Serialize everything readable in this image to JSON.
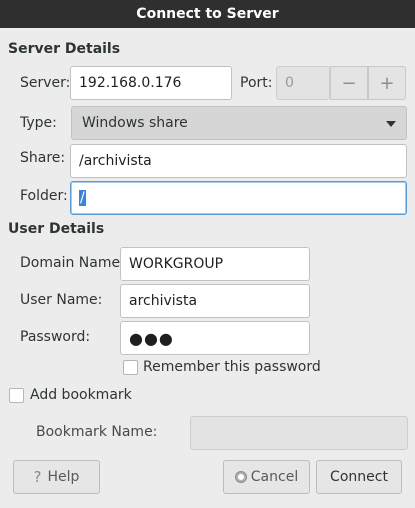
{
  "window": {
    "title": "Connect to Server"
  },
  "server_details": {
    "heading": "Server Details",
    "server_label": "Server:",
    "server_value": "192.168.0.176",
    "port_label": "Port:",
    "port_value": "0",
    "port_minus": "−",
    "port_plus": "+",
    "type_label": "Type:",
    "type_value": "Windows share",
    "share_label": "Share:",
    "share_value": "/archivista",
    "folder_label": "Folder:",
    "folder_value": "/"
  },
  "user_details": {
    "heading": "User Details",
    "domain_label": "Domain Name:",
    "domain_value": "WORKGROUP",
    "user_label": "User Name:",
    "user_value": "archivista",
    "password_label": "Password:",
    "password_value": "●●●",
    "remember_label": "Remember this password"
  },
  "bookmark": {
    "add_label": "Add bookmark",
    "name_label": "Bookmark Name:",
    "name_value": ""
  },
  "buttons": {
    "help": "Help",
    "help_icon": "?",
    "cancel": "Cancel",
    "connect": "Connect"
  },
  "colors": {
    "titlebar": "#2f2f2f",
    "background": "#ececec",
    "selection": "#3b84d6"
  }
}
